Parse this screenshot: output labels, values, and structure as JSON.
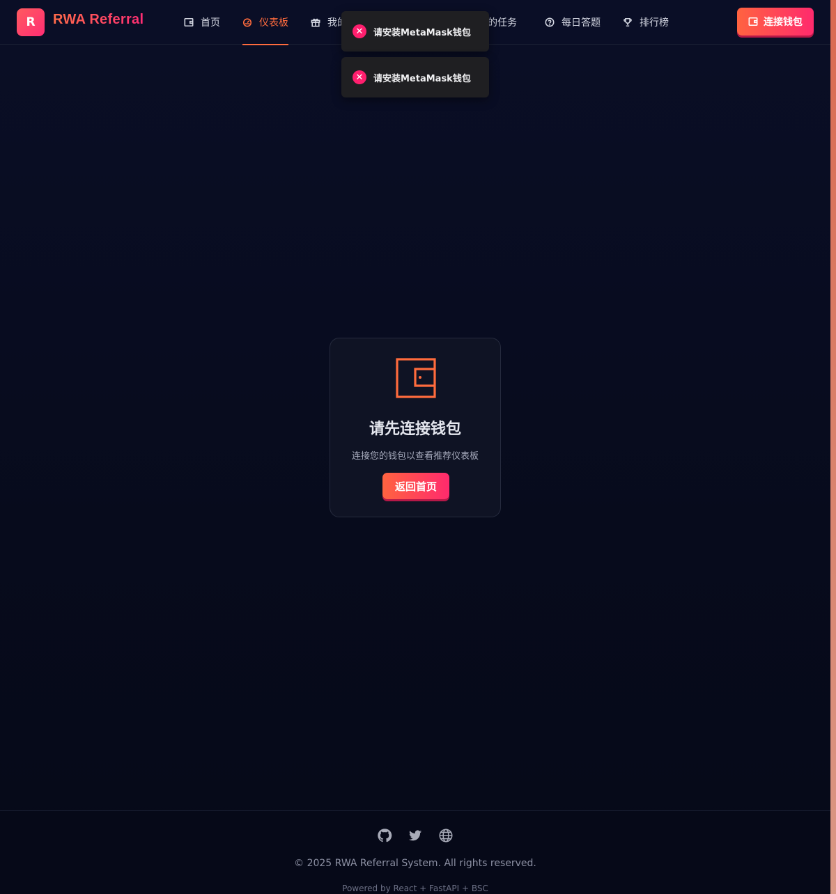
{
  "header": {
    "logo_letter": "R",
    "brand": "RWA Referral",
    "nav": [
      {
        "label": "首页",
        "icon": "wallet-icon"
      },
      {
        "label": "仪表板",
        "icon": "dashboard-icon",
        "active": true
      },
      {
        "label": "我的",
        "icon": "gift-icon"
      },
      {
        "label": "我的任务",
        "icon": "task-icon"
      },
      {
        "label": "每日答题",
        "icon": "help-circle-icon"
      },
      {
        "label": "排行榜",
        "icon": "trophy-icon"
      }
    ],
    "connect_label": "连接钱包"
  },
  "toasts": [
    {
      "message": "请安装MetaMask钱包",
      "icon": "error-x-icon"
    },
    {
      "message": "请安装MetaMask钱包",
      "icon": "error-x-icon"
    }
  ],
  "card": {
    "icon": "wallet-icon",
    "title": "请先连接钱包",
    "subtitle": "连接您的钱包以查看推荐仪表板",
    "button_label": "返回首页"
  },
  "footer": {
    "social": [
      "github-icon",
      "twitter-icon",
      "globe-icon"
    ],
    "copyright": "© 2025 RWA Referral System. All rights reserved.",
    "powered": "Powered by React + FastAPI + BSC"
  },
  "colors": {
    "accent": "#ff6b3d",
    "accent_pink": "#ff2a6d",
    "background": "#080c1e",
    "toast_bg": "#1f1f22",
    "error": "#ff1f6e"
  }
}
